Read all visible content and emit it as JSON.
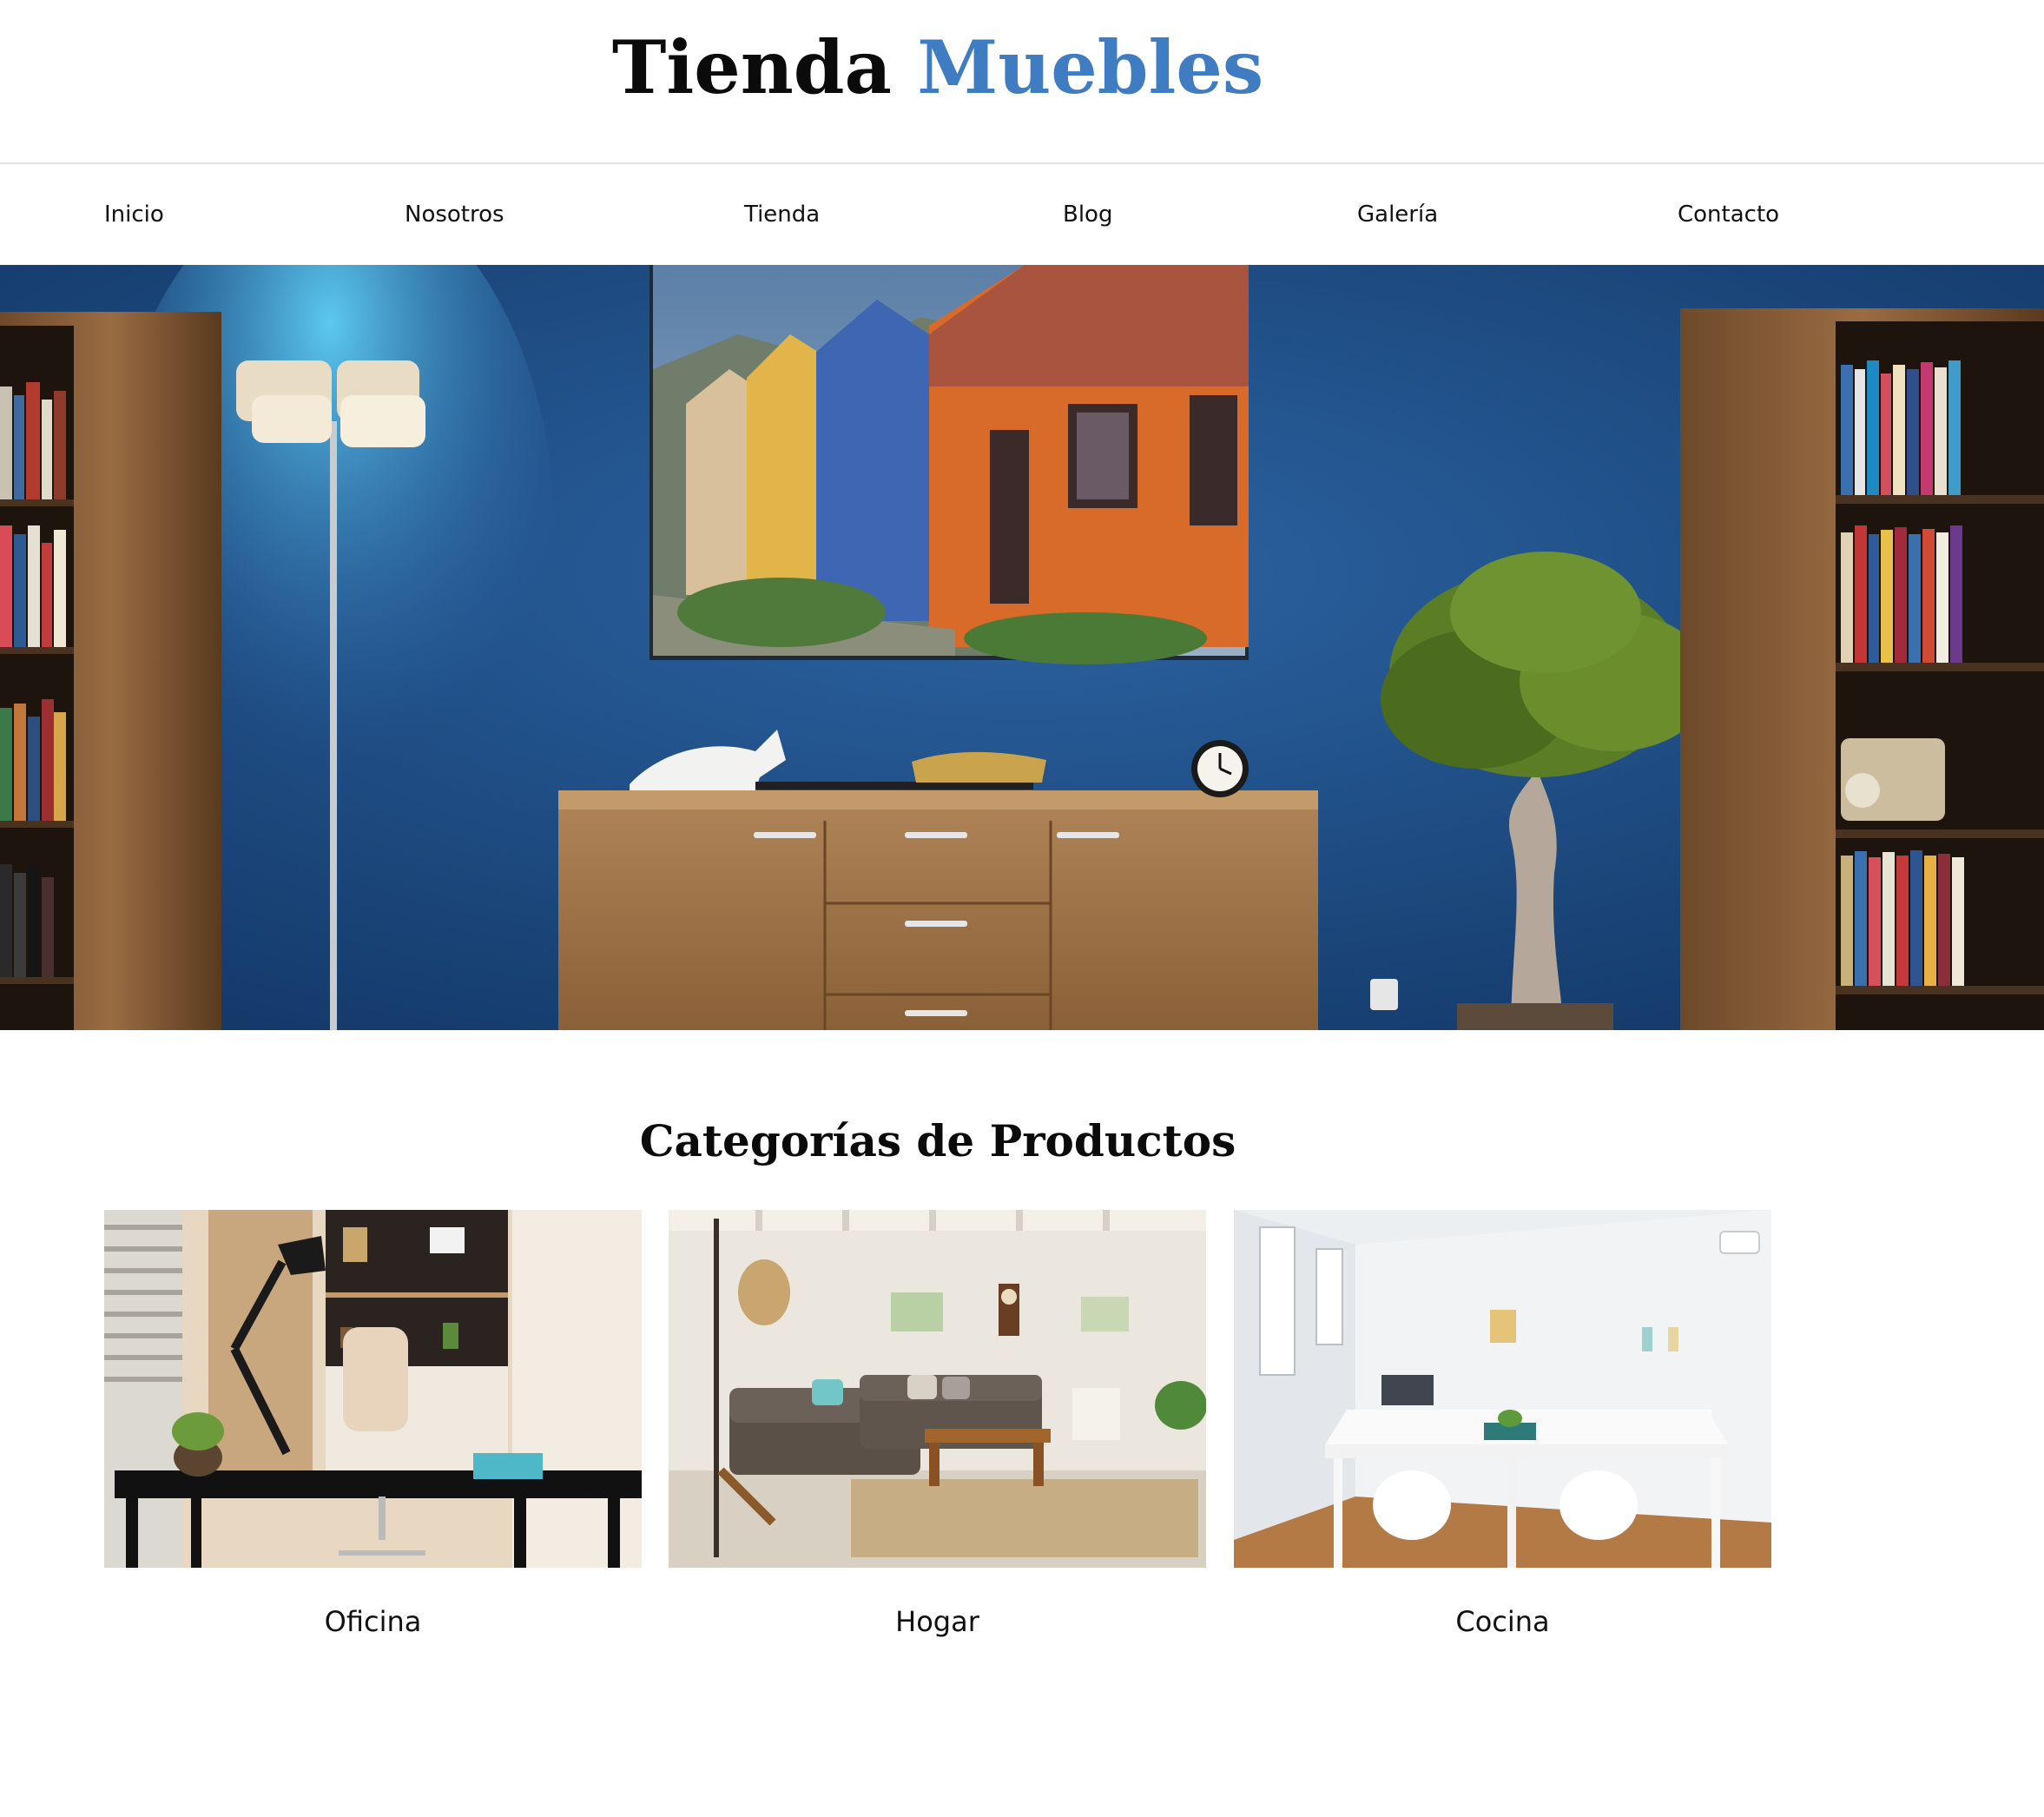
{
  "header": {
    "logo_main": "Tienda",
    "logo_accent": "Muebles",
    "accent_color": "#3f7cc1"
  },
  "nav": {
    "items": [
      {
        "label": "Inicio"
      },
      {
        "label": "Nosotros"
      },
      {
        "label": "Tienda"
      },
      {
        "label": "Blog"
      },
      {
        "label": "Galería"
      },
      {
        "label": "Contacto"
      }
    ]
  },
  "categories": {
    "title": "Categorías de Productos",
    "items": [
      {
        "label": "Oficina"
      },
      {
        "label": "Hogar"
      },
      {
        "label": "Cocina"
      }
    ]
  }
}
